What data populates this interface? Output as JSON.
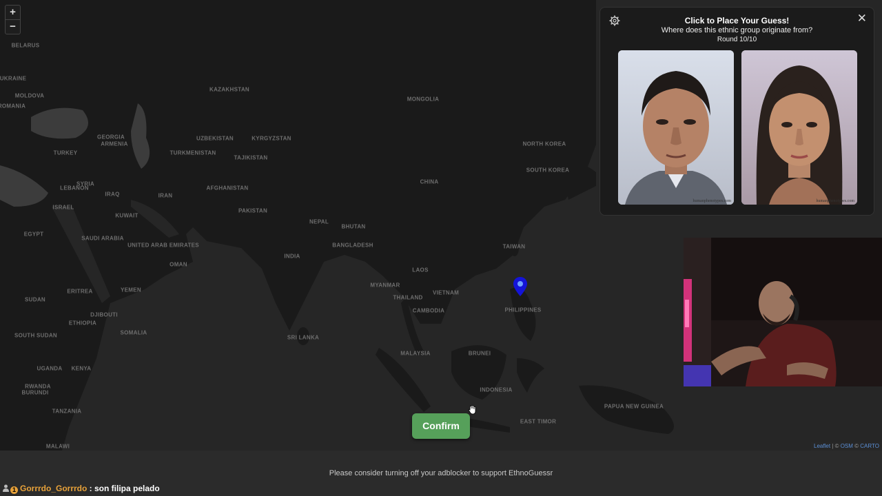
{
  "map": {
    "zoom_in": "+",
    "zoom_out": "−",
    "labels": [
      "BELARUS",
      "UKRAINE",
      "MOLDOVA",
      "ROMANIA",
      "KAZAKHSTAN",
      "MONGOLIA",
      "GEORGIA",
      "ARMENIA",
      "UZBEKISTAN",
      "KYRGYZSTAN",
      "TURKEY",
      "TURKMENISTAN",
      "TAJIKISTAN",
      "NORTH KOREA",
      "SOUTH KOREA",
      "SYRIA",
      "LEBANON",
      "IRAQ",
      "ISRAEL",
      "IRAN",
      "AFGHANISTAN",
      "PAKISTAN",
      "CHINA",
      "KUWAIT",
      "NEPAL",
      "BHUTAN",
      "EGYPT",
      "SAUDI ARABIA",
      "UNITED ARAB EMIRATES",
      "OMAN",
      "BANGLADESH",
      "TAIWAN",
      "INDIA",
      "MYANMAR",
      "LAOS",
      "YEMEN",
      "ERITREA",
      "THAILAND",
      "VIETNAM",
      "PHILIPPINES",
      "SUDAN",
      "DJIBOUTI",
      "ETHIOPIA",
      "CAMBODIA",
      "SOMALIA",
      "SRI LANKA",
      "SOUTH SUDAN",
      "MALAYSIA",
      "BRUNEI",
      "UGANDA",
      "KENYA",
      "RWANDA",
      "BURUNDI",
      "INDONESIA",
      "TANZANIA",
      "PAPUA NEW GUINEA",
      "MALAWI",
      "EAST TIMOR"
    ],
    "attribution": {
      "leaflet": "Leaflet",
      "sep1": " | © ",
      "osm": "OSM",
      "sep2": " © ",
      "carto": "CARTO"
    }
  },
  "panel": {
    "title": "Click to Place Your Guess!",
    "subtitle": "Where does this ethnic group originate from?",
    "round": "Round 10/10",
    "watermark": "humanphenotypes.com"
  },
  "confirm_label": "Confirm",
  "footer": {
    "adblock": "Please consider turning off your adblocker to support EthnoGuessr"
  },
  "chat": {
    "badge": "1",
    "user": "Gorrrdo_Gorrrdo",
    "message": " : son filipa pelado"
  },
  "colors": {
    "map_bg": "#262626",
    "land": "#1a1a1a",
    "confirm": "#56a05a",
    "pin": "#1414d8",
    "chat_user": "#e8a23a"
  }
}
